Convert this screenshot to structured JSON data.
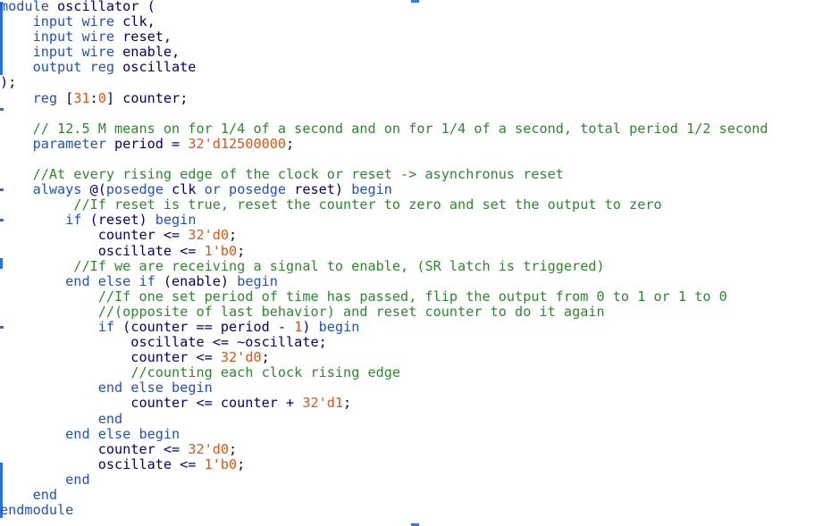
{
  "editor": {
    "language": "verilog",
    "colors": {
      "keyword": "#1f4fc9",
      "number": "#e8520c",
      "comment": "#2a8a2a",
      "plain": "#000080",
      "gutter_marker": "#2f6fd6",
      "background": "#ffffff"
    },
    "lines": [
      [
        {
          "t": "kw",
          "v": "module"
        },
        {
          "t": "pl",
          "v": " oscillator ("
        }
      ],
      [
        {
          "t": "pl",
          "v": "    "
        },
        {
          "t": "kw",
          "v": "input wire"
        },
        {
          "t": "pl",
          "v": " clk,"
        }
      ],
      [
        {
          "t": "pl",
          "v": "    "
        },
        {
          "t": "kw",
          "v": "input wire"
        },
        {
          "t": "pl",
          "v": " reset,"
        }
      ],
      [
        {
          "t": "pl",
          "v": "    "
        },
        {
          "t": "kw",
          "v": "input wire"
        },
        {
          "t": "pl",
          "v": " enable,"
        }
      ],
      [
        {
          "t": "pl",
          "v": "    "
        },
        {
          "t": "kw",
          "v": "output reg"
        },
        {
          "t": "pl",
          "v": " oscillate"
        }
      ],
      [
        {
          "t": "pl",
          "v": ");"
        }
      ],
      [
        {
          "t": "pl",
          "v": "    "
        },
        {
          "t": "kw",
          "v": "reg"
        },
        {
          "t": "pl",
          "v": " ["
        },
        {
          "t": "num",
          "v": "31"
        },
        {
          "t": "pl",
          "v": ":"
        },
        {
          "t": "num",
          "v": "0"
        },
        {
          "t": "pl",
          "v": "] counter;"
        }
      ],
      [],
      [
        {
          "t": "pl",
          "v": "    "
        },
        {
          "t": "cmt",
          "v": "// 12.5 M means on for 1/4 of a second and on for 1/4 of a second, total period 1/2 second"
        }
      ],
      [
        {
          "t": "pl",
          "v": "    "
        },
        {
          "t": "kw",
          "v": "parameter"
        },
        {
          "t": "pl",
          "v": " period = "
        },
        {
          "t": "num",
          "v": "32'd12500000"
        },
        {
          "t": "pl",
          "v": ";"
        }
      ],
      [],
      [
        {
          "t": "pl",
          "v": "    "
        },
        {
          "t": "cmt",
          "v": "//At every rising edge of the clock or reset -> asynchronus reset"
        }
      ],
      [
        {
          "t": "pl",
          "v": "    "
        },
        {
          "t": "kw",
          "v": "always"
        },
        {
          "t": "pl",
          "v": " @("
        },
        {
          "t": "kw",
          "v": "posedge"
        },
        {
          "t": "pl",
          "v": " clk "
        },
        {
          "t": "kw",
          "v": "or posedge"
        },
        {
          "t": "pl",
          "v": " reset) "
        },
        {
          "t": "kw",
          "v": "begin"
        }
      ],
      [
        {
          "t": "pl",
          "v": "         "
        },
        {
          "t": "cmt",
          "v": "//If reset is true, reset the counter to zero and set the output to zero"
        }
      ],
      [
        {
          "t": "pl",
          "v": "        "
        },
        {
          "t": "kw",
          "v": "if"
        },
        {
          "t": "pl",
          "v": " (reset) "
        },
        {
          "t": "kw",
          "v": "begin"
        }
      ],
      [
        {
          "t": "pl",
          "v": "            counter <= "
        },
        {
          "t": "num",
          "v": "32'd0"
        },
        {
          "t": "pl",
          "v": ";"
        }
      ],
      [
        {
          "t": "pl",
          "v": "            oscillate <= "
        },
        {
          "t": "num",
          "v": "1'b0"
        },
        {
          "t": "pl",
          "v": ";"
        }
      ],
      [
        {
          "t": "pl",
          "v": "         "
        },
        {
          "t": "cmt",
          "v": "//If we are receiving a signal to enable, (SR latch is triggered)"
        }
      ],
      [
        {
          "t": "pl",
          "v": "        "
        },
        {
          "t": "kw",
          "v": "end else if"
        },
        {
          "t": "pl",
          "v": " (enable) "
        },
        {
          "t": "kw",
          "v": "begin"
        }
      ],
      [
        {
          "t": "pl",
          "v": "            "
        },
        {
          "t": "cmt",
          "v": "//If one set period of time has passed, flip the output from 0 to 1 or 1 to 0"
        }
      ],
      [
        {
          "t": "pl",
          "v": "            "
        },
        {
          "t": "cmt",
          "v": "//(opposite of last behavior) and reset counter to do it again"
        }
      ],
      [
        {
          "t": "pl",
          "v": "            "
        },
        {
          "t": "kw",
          "v": "if"
        },
        {
          "t": "pl",
          "v": " (counter == period - "
        },
        {
          "t": "num",
          "v": "1"
        },
        {
          "t": "pl",
          "v": ") "
        },
        {
          "t": "kw",
          "v": "begin"
        }
      ],
      [
        {
          "t": "pl",
          "v": "                oscillate <= ~oscillate;"
        }
      ],
      [
        {
          "t": "pl",
          "v": "                counter <= "
        },
        {
          "t": "num",
          "v": "32'd0"
        },
        {
          "t": "pl",
          "v": ";"
        }
      ],
      [
        {
          "t": "pl",
          "v": "                "
        },
        {
          "t": "cmt",
          "v": "//counting each clock rising edge"
        }
      ],
      [
        {
          "t": "pl",
          "v": "            "
        },
        {
          "t": "kw",
          "v": "end else begin"
        }
      ],
      [
        {
          "t": "pl",
          "v": "                counter <= counter + "
        },
        {
          "t": "num",
          "v": "32'd1"
        },
        {
          "t": "pl",
          "v": ";"
        }
      ],
      [
        {
          "t": "pl",
          "v": "            "
        },
        {
          "t": "kw",
          "v": "end"
        }
      ],
      [
        {
          "t": "pl",
          "v": "        "
        },
        {
          "t": "kw",
          "v": "end else begin"
        }
      ],
      [
        {
          "t": "pl",
          "v": "            counter <= "
        },
        {
          "t": "num",
          "v": "32'd0"
        },
        {
          "t": "pl",
          "v": ";"
        }
      ],
      [
        {
          "t": "pl",
          "v": "            oscillate <= "
        },
        {
          "t": "num",
          "v": "1'b0"
        },
        {
          "t": "pl",
          "v": ";"
        }
      ],
      [
        {
          "t": "pl",
          "v": "        "
        },
        {
          "t": "kw",
          "v": "end"
        }
      ],
      [
        {
          "t": "pl",
          "v": "    "
        },
        {
          "t": "kw",
          "v": "end"
        }
      ],
      [
        {
          "t": "kw",
          "v": "endmodule"
        }
      ]
    ]
  }
}
